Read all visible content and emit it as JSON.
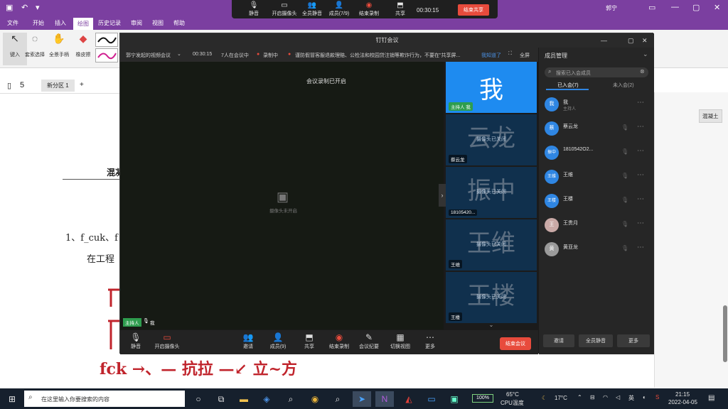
{
  "onenote": {
    "menu_tabs": [
      "文件",
      "开始",
      "插入",
      "绘图",
      "历史记录",
      "审阅",
      "视图",
      "帮助"
    ],
    "user": "郭宁",
    "ribbon": [
      "键入",
      "套索选择",
      "全景手柄",
      "橡皮擦"
    ],
    "section_page_number": "5",
    "section_tab": "新分区 1",
    "add_tab": "+",
    "right_tag": "混凝土",
    "doc_heading": "混凝",
    "doc_line1": "1、f_cuk、f",
    "doc_line2": "在工程",
    "ink": [
      "fck  →、— 抗拉 —↙   立~方",
      "护",
      "凝土"
    ]
  },
  "meeting_topbar": {
    "items": [
      {
        "icon": "microphone-icon",
        "label": "静音"
      },
      {
        "icon": "camera-icon",
        "label": "开启摄像头"
      },
      {
        "icon": "mute-all-icon",
        "label": "全员静音"
      },
      {
        "icon": "members-icon",
        "label": "成员(7/9)"
      },
      {
        "icon": "record-icon",
        "label": "结束录制"
      },
      {
        "icon": "share-icon",
        "label": "共享"
      }
    ],
    "timer": "00:30:15",
    "end_share_label": "结束共享"
  },
  "meeting": {
    "window_title": "钉钉会议",
    "meeting_name": "郭宁发起的视频会议",
    "duration": "00:30:15",
    "participants_in_meeting": "7人在会议中",
    "recording": "录制中",
    "notice": "谨防假冒客服退款理赔、公检法和校园贷注销等欺诈行为，不要在\"共享屏...",
    "notice_link": "我知道了",
    "fullscreen": "全屏",
    "recording_started": "会议录制已开启",
    "camera_off_text": "摄像头未开启",
    "host_tag": "主持人",
    "me": "我",
    "tiles": [
      {
        "big": "我",
        "caption": "",
        "tag": "主持人  我",
        "highlight": true
      },
      {
        "big": "云龙",
        "caption": "摄像头已关闭",
        "tag": "蔡云龙",
        "highlight": false
      },
      {
        "big": "振中",
        "caption": "摄像头已关闭",
        "tag": "18105420...",
        "highlight": false
      },
      {
        "big": "王维",
        "caption": "摄像头已关闭",
        "tag": "王维",
        "highlight": false
      },
      {
        "big": "王楼",
        "caption": "摄像头已关闭",
        "tag": "王楼",
        "highlight": false
      }
    ],
    "controls": [
      {
        "icon": "microphone-icon",
        "label": "静音"
      },
      {
        "icon": "camera-icon",
        "label": "开启摄像头"
      },
      {
        "icon": "invite-icon",
        "label": "邀请"
      },
      {
        "icon": "members-icon",
        "label": "成员(9)"
      },
      {
        "icon": "share-icon",
        "label": "共享"
      },
      {
        "icon": "record-icon",
        "label": "结束录制"
      },
      {
        "icon": "minutes-icon",
        "label": "会议纪要"
      },
      {
        "icon": "grid-icon",
        "label": "切换视图"
      },
      {
        "icon": "more-icon",
        "label": "更多"
      }
    ],
    "end_meeting": "结束会议"
  },
  "members_panel": {
    "title": "成员管理",
    "search_placeholder": "搜索已入会成员",
    "tab_joined": "已入会(7)",
    "tab_not_joined": "未入会(2)",
    "members": [
      {
        "avatar": "我",
        "name": "我",
        "sub": "主持人"
      },
      {
        "avatar": "蔡",
        "name": "蔡云龙",
        "sub": ""
      },
      {
        "avatar": "振中",
        "name": "1810542O2...",
        "sub": ""
      },
      {
        "avatar": "王维",
        "name": "王维",
        "sub": ""
      },
      {
        "avatar": "王楼",
        "name": "王楼",
        "sub": ""
      },
      {
        "avatar": "王",
        "name": "王贵月",
        "sub": ""
      },
      {
        "avatar": "黄",
        "name": "黄亚龙",
        "sub": ""
      }
    ],
    "invite": "邀请",
    "mute_all": "全员静音",
    "more": "更多"
  },
  "taskbar": {
    "search_placeholder": "在这里输入你要搜索的内容",
    "battery": "100%",
    "cpu_temp": "65°C",
    "cpu_label": "CPU温度",
    "weather": "17°C",
    "ime": "英",
    "time": "21:15",
    "date": "2022-04-05"
  },
  "colors": {
    "onenote_purple": "#7b3fa0",
    "dingtalk_blue": "#2f86e3",
    "end_red": "#e84b3c",
    "ink_red": "#c0242c"
  }
}
